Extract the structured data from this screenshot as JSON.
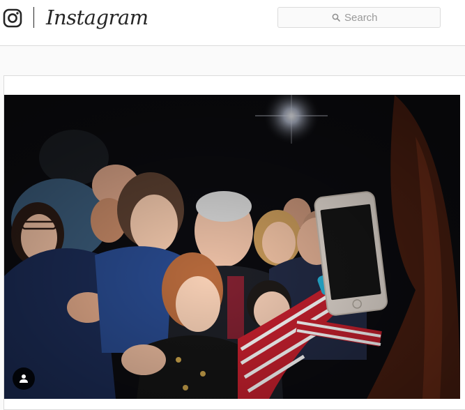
{
  "header": {
    "brand": "Instagram",
    "search": {
      "placeholder": "Search",
      "value": ""
    }
  },
  "post": {
    "tagged_people_icon": "person-icon"
  },
  "colors": {
    "header_bg": "#ffffff",
    "page_bg": "#fafafa",
    "border": "#dbdbdb",
    "text": "#262626"
  }
}
